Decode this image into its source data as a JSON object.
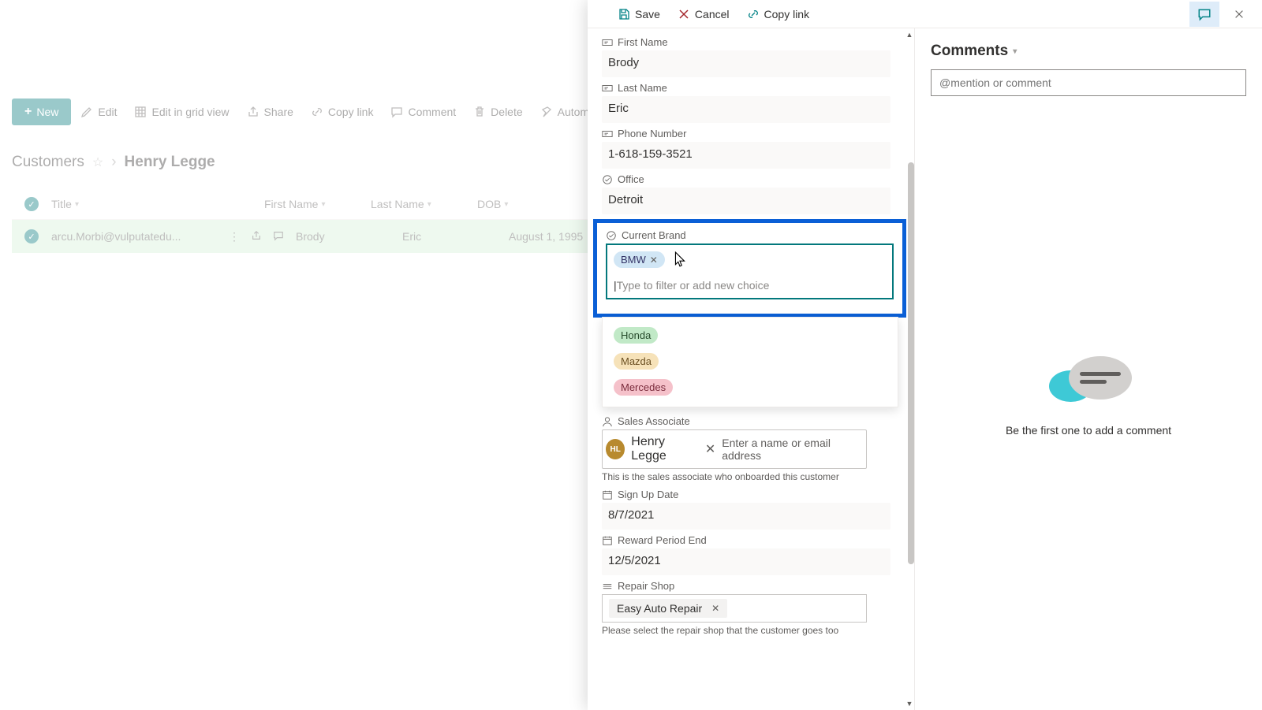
{
  "toolbar": {
    "new": "New",
    "edit": "Edit",
    "edit_grid": "Edit in grid view",
    "share": "Share",
    "copy_link": "Copy link",
    "comment": "Comment",
    "delete": "Delete",
    "automate": "Automate"
  },
  "breadcrumb": {
    "root": "Customers",
    "current": "Henry Legge"
  },
  "table": {
    "columns": {
      "title": "Title",
      "first": "First Name",
      "last": "Last Name",
      "dob": "DOB"
    },
    "rows": [
      {
        "title": "arcu.Morbi@vulputatedu...",
        "first": "Brody",
        "last": "Eric",
        "dob": "August 1, 1995"
      }
    ]
  },
  "panel": {
    "save": "Save",
    "cancel": "Cancel",
    "copy_link": "Copy link"
  },
  "form": {
    "first_name": {
      "label": "First Name",
      "value": "Brody"
    },
    "last_name": {
      "label": "Last Name",
      "value": "Eric"
    },
    "phone": {
      "label": "Phone Number",
      "value": "1-618-159-3521"
    },
    "office": {
      "label": "Office",
      "value": "Detroit"
    },
    "current_brand": {
      "label": "Current Brand",
      "selected": "BMW",
      "filter_placeholder": "Type to filter or add new choice",
      "options": [
        "Honda",
        "Mazda",
        "Mercedes"
      ]
    },
    "sales_associate": {
      "label": "Sales Associate",
      "initials": "HL",
      "name": "Henry Legge",
      "placeholder": "Enter a name or email address",
      "desc": "This is the sales associate who onboarded this customer"
    },
    "sign_up": {
      "label": "Sign Up Date",
      "value": "8/7/2021"
    },
    "reward_end": {
      "label": "Reward Period End",
      "value": "12/5/2021"
    },
    "repair": {
      "label": "Repair Shop",
      "value": "Easy Auto Repair",
      "desc": "Please select the repair shop that the customer goes too"
    }
  },
  "comments": {
    "title": "Comments",
    "placeholder": "@mention or comment",
    "empty": "Be the first one to add a comment"
  }
}
